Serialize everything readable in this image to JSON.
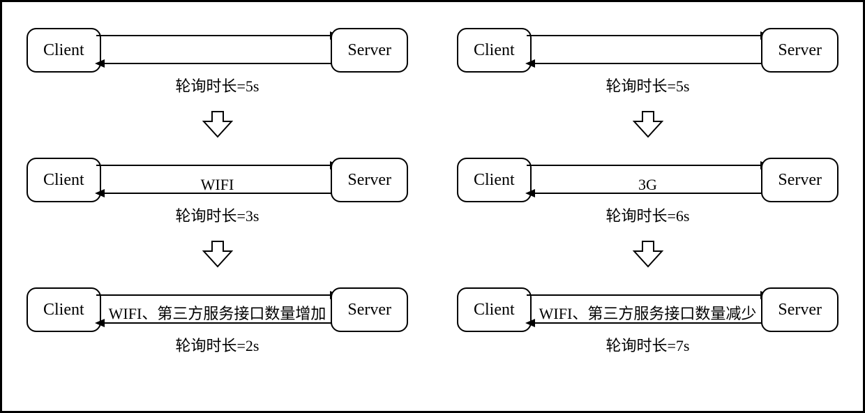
{
  "client_label": "Client",
  "server_label": "Server",
  "left": {
    "stage1": {
      "top": "",
      "bottom": "轮询时长=5s"
    },
    "stage2": {
      "top": "WIFI",
      "bottom": "轮询时长=3s"
    },
    "stage3": {
      "top": "WIFI、第三方服务接口数量增加",
      "bottom": "轮询时长=2s"
    }
  },
  "right": {
    "stage1": {
      "top": "",
      "bottom": "轮询时长=5s"
    },
    "stage2": {
      "top": "3G",
      "bottom": "轮询时长=6s"
    },
    "stage3": {
      "top": "WIFI、第三方服务接口数量减少",
      "bottom": "轮询时长=7s"
    }
  }
}
